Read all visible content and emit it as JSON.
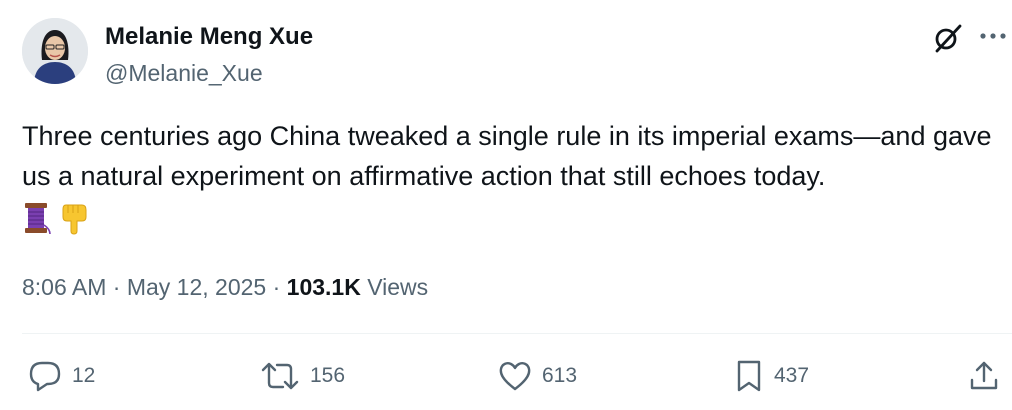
{
  "author": {
    "name": "Melanie Meng Xue",
    "handle": "@Melanie_Xue"
  },
  "tweet": {
    "text": "Three centuries ago China tweaked a single rule in its imperial exams—and gave us a natural experiment on affirmative action that still echoes today.",
    "emojis": [
      "thread-spool-icon",
      "pointing-down-icon"
    ],
    "time": "8:06 AM",
    "separator": "·",
    "date": "May 12, 2025",
    "views_count": "103.1K",
    "views_label": "Views"
  },
  "actions": {
    "replies": "12",
    "reposts": "156",
    "likes": "613",
    "bookmarks": "437"
  },
  "colors": {
    "text": "#0f1419",
    "secondary": "#536471",
    "divider": "#eff3f4"
  }
}
